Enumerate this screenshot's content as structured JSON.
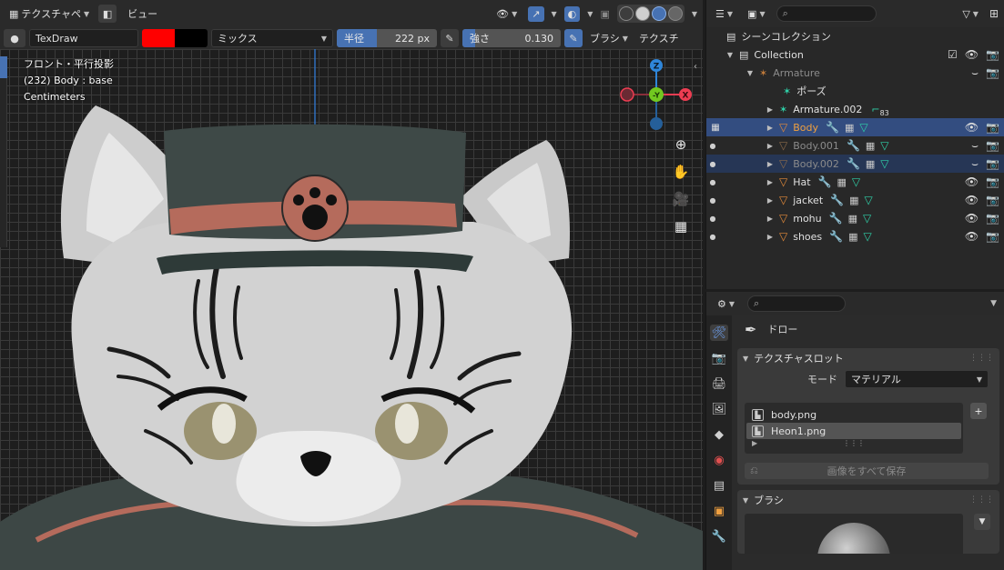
{
  "viewport_header": {
    "mode_label": "テクスチャペ",
    "view_menu": "ビュー"
  },
  "tool_settings": {
    "brush_name": "TexDraw",
    "brush_color": "#ff0000",
    "blend_mode": "ミックス",
    "radius_label": "半径",
    "radius_value": "222 px",
    "strength_label": "強さ",
    "strength_value": "0.130",
    "strength_fraction": 0.13,
    "brush_menu": "ブラシ",
    "texture_menu": "テクスチ"
  },
  "viewport_overlay": {
    "view_name": "フロント・平行投影",
    "object_info": "(232) Body : base",
    "units": "Centimeters"
  },
  "gizmo": {
    "z_label": "Z",
    "y_label": "-Y",
    "x_label": "X",
    "colors": {
      "x": "#ed3d52",
      "y": "#72c820",
      "z": "#2f86d9"
    }
  },
  "outliner": {
    "scene_collection": "シーンコレクション",
    "rows": [
      {
        "label": "Collection",
        "style": "normal"
      },
      {
        "label": "Armature",
        "style": "muted"
      },
      {
        "label": "ポーズ",
        "style": "normal"
      },
      {
        "label": "Armature.002",
        "style": "normal",
        "badge": "83"
      },
      {
        "label": "Body",
        "style": "orange"
      },
      {
        "label": "Body.001",
        "style": "muted"
      },
      {
        "label": "Body.002",
        "style": "muted"
      },
      {
        "label": "Hat",
        "style": "normal"
      },
      {
        "label": "jacket",
        "style": "normal"
      },
      {
        "label": "mohu",
        "style": "normal"
      },
      {
        "label": "shoes",
        "style": "normal"
      }
    ]
  },
  "properties": {
    "tool_title": "ドロー",
    "texture_slots_title": "テクスチャスロット",
    "mode_label": "モード",
    "mode_value": "マテリアル",
    "slots": [
      "body.png",
      "Heon1.png"
    ],
    "save_all_label": "画像をすべて保存",
    "brush_panel_title": "ブラシ"
  },
  "colors": {
    "selection": "#334d80",
    "accent": "#4772b3",
    "hat": "#3b4644",
    "hat_band": "#b56b5c",
    "fur": "#cfcfcf"
  }
}
